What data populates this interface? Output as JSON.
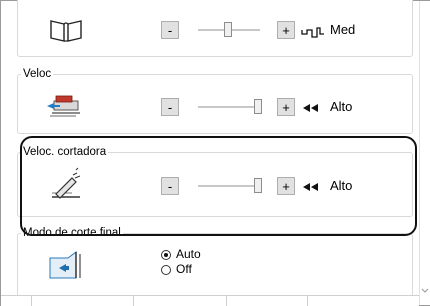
{
  "rows": [
    {
      "title": "",
      "icon": "book-open-icon",
      "value": "Med",
      "indicator": "medium-wave-icon",
      "level": 0.5
    },
    {
      "title": "Veloc",
      "icon": "feed-speed-icon",
      "value": "Alto",
      "indicator": "fast-arrows-icon",
      "level": 1.0
    },
    {
      "title": "Veloc. cortadora",
      "icon": "cutter-speed-icon",
      "value": "Alto",
      "indicator": "fast-arrows-icon",
      "level": 1.0
    }
  ],
  "buttons": {
    "minus": "-",
    "plus": "+"
  },
  "final_cut": {
    "title": "Modo de corte final",
    "icon": "final-cut-icon",
    "options": [
      {
        "label": "Auto",
        "selected": true
      },
      {
        "label": "Off",
        "selected": false
      }
    ]
  }
}
